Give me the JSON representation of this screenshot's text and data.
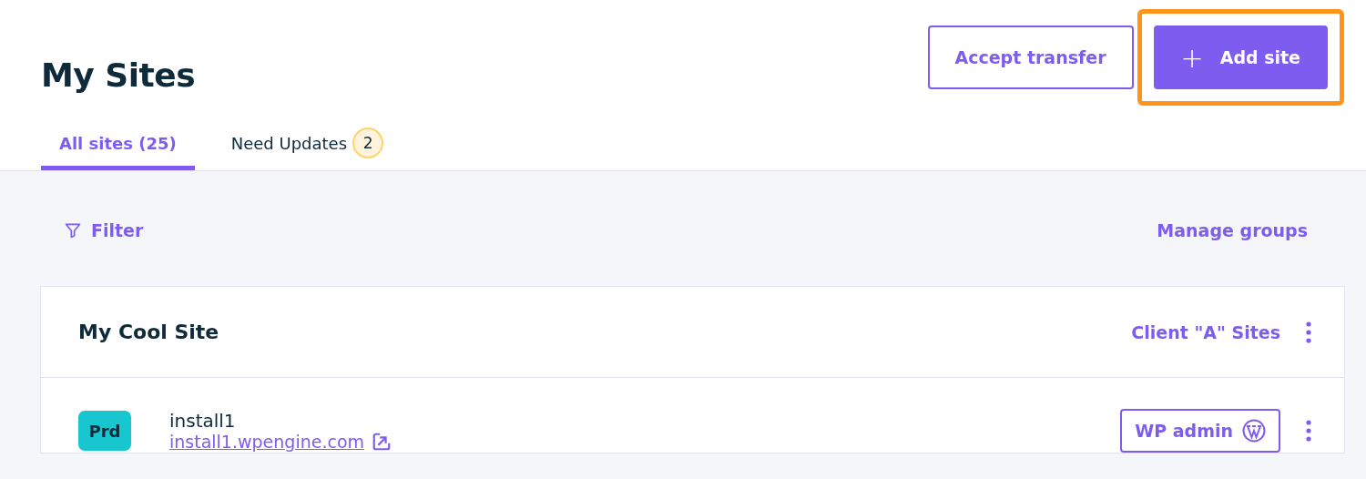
{
  "page": {
    "title": "My Sites"
  },
  "actions": [
    {
      "kind": "outline",
      "label": "Accept transfer",
      "highlighted": false
    },
    {
      "kind": "primary",
      "label": "Add site",
      "icon": "+",
      "highlighted": true
    }
  ],
  "tabs": [
    {
      "label": "All sites (25)",
      "selected": true
    },
    {
      "label": "Need Updates",
      "badge": "2",
      "selected": false
    }
  ],
  "toolbar": {
    "filter": "Filter",
    "manage": "Manage groups"
  },
  "site": {
    "name": "My Cool Site",
    "group": "Client \"A\" Sites",
    "installs": [
      {
        "env": "Prd",
        "color": "#17c6cf",
        "name": "install1",
        "url": "install1.wpengine.com",
        "admin": "WP admin"
      }
    ]
  }
}
